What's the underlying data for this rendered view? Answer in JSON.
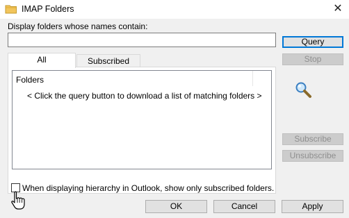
{
  "window": {
    "title": "IMAP Folders",
    "icons": {
      "title": "folder-icon",
      "close": "close-icon"
    }
  },
  "filter": {
    "label": "Display folders whose names contain:",
    "value": ""
  },
  "buttons": {
    "query": "Query",
    "stop": "Stop",
    "subscribe": "Subscribe",
    "unsubscribe": "Unsubscribe",
    "ok": "OK",
    "cancel": "Cancel",
    "apply": "Apply"
  },
  "tabs": {
    "all": "All",
    "subscribed": "Subscribed",
    "active": "All"
  },
  "list": {
    "column_header": "Folders",
    "message": "< Click the query button to download a list of matching folders >"
  },
  "option": {
    "label": "When displaying hierarchy in Outlook, show only subscribed folders.",
    "checked": false
  },
  "icons": {
    "search": "magnifier-icon",
    "cursor": "hand-cursor-icon"
  },
  "colors": {
    "accent": "#0078d7",
    "disabled_text": "#8f8f8f",
    "dialog_bg": "#f0f0f0"
  }
}
